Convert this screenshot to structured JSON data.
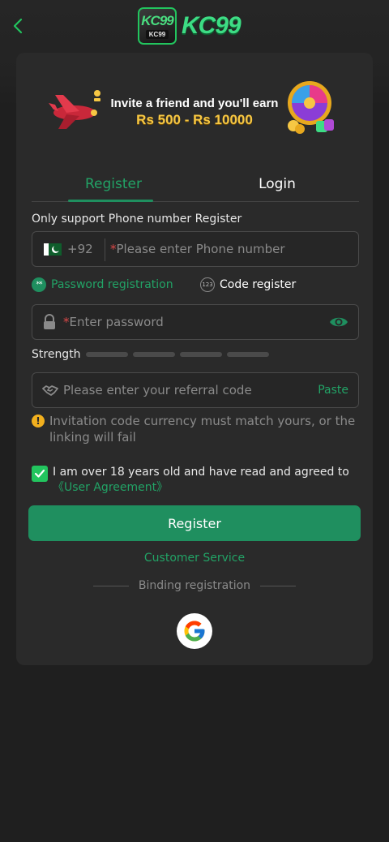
{
  "logo": {
    "badge_top": "KC99",
    "badge_bottom": "KC99",
    "wordmark": "KC99"
  },
  "banner": {
    "line1": "Invite a friend and you'll earn",
    "line2": "Rs 500 - Rs 10000"
  },
  "tabs": [
    {
      "label": "Register",
      "active": true
    },
    {
      "label": "Login",
      "active": false
    }
  ],
  "form": {
    "support_hint": "Only support Phone number Register",
    "phone": {
      "country_code": "+92",
      "required_mark": "*",
      "placeholder": "Please enter Phone number"
    },
    "modes": [
      {
        "icon": "**",
        "label": "Password registration",
        "selected": true
      },
      {
        "icon": "123",
        "label": "Code register",
        "selected": false
      }
    ],
    "password": {
      "required_mark": "*",
      "placeholder": "Enter password"
    },
    "strength": {
      "label": "Strength",
      "level": 0,
      "segments": 4
    },
    "referral": {
      "placeholder": "Please enter your referral code",
      "paste_label": "Paste"
    },
    "warning": {
      "icon": "!",
      "text": "Invitation code currency must match yours, or the linking will fail"
    },
    "agreement": {
      "checked": true,
      "text": "I am over 18 years old and have read and agreed to",
      "link": "《User Agreement》"
    },
    "submit_label": "Register"
  },
  "customer_service": "Customer Service",
  "binding_label": "Binding registration",
  "colors": {
    "accent": "#1f8f5f",
    "accent_text": "#22a366",
    "background": "#1f1f1f",
    "card": "#2a2a2a",
    "required": "#d94848",
    "warning": "#f2b01e"
  },
  "icons": [
    "chevron-left-icon",
    "pakistan-flag-icon",
    "lock-icon",
    "eye-icon",
    "handshake-icon",
    "warning-icon",
    "checkbox-check-icon",
    "google-icon"
  ]
}
